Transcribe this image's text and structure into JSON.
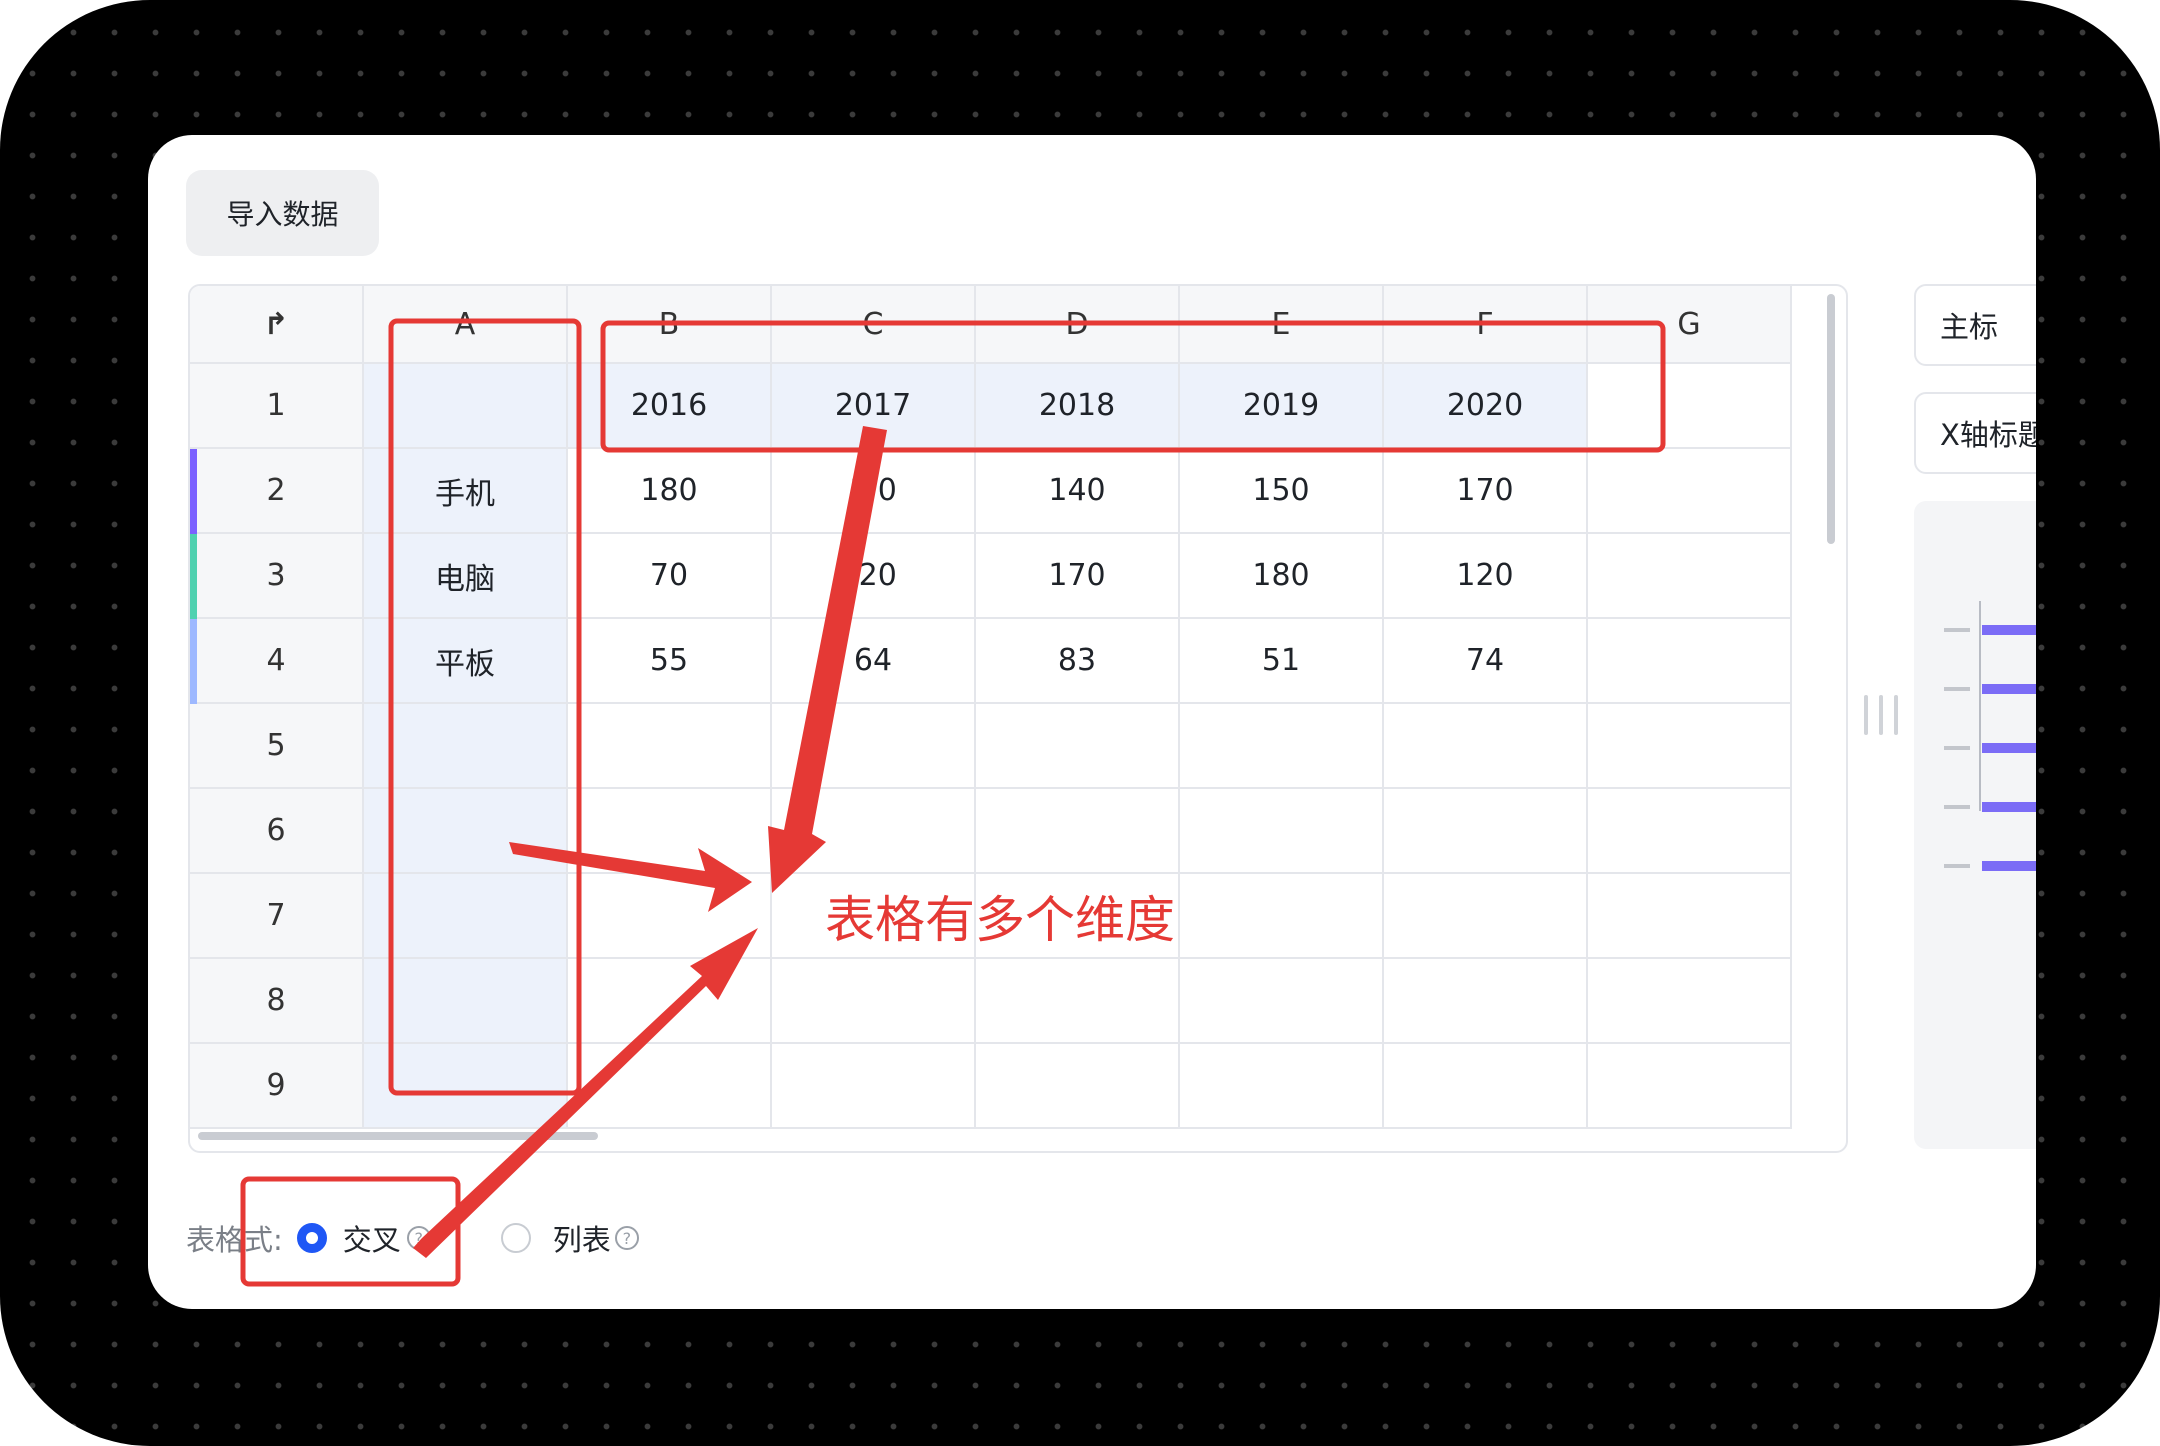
{
  "toolbar": {
    "import_label": "导入数据"
  },
  "sheet": {
    "corner_icon": "return-arrow-icon",
    "columns": [
      "A",
      "B",
      "C",
      "D",
      "E",
      "F",
      "G"
    ],
    "rows": [
      [
        "",
        "2016",
        "2017",
        "2018",
        "2019",
        "2020",
        ""
      ],
      [
        "手机",
        "180",
        "1·0",
        "140",
        "150",
        "170",
        ""
      ],
      [
        "电脑",
        "70",
        "·20",
        "170",
        "180",
        "120",
        ""
      ],
      [
        "平板",
        "55",
        "64",
        "83",
        "51",
        "74",
        ""
      ],
      [
        "",
        "",
        "",
        "",
        "",
        "",
        ""
      ],
      [
        "",
        "",
        "",
        "",
        "",
        "",
        ""
      ],
      [
        "",
        "",
        "",
        "",
        "",
        "",
        ""
      ],
      [
        "",
        "",
        "",
        "",
        "",
        "",
        ""
      ],
      [
        "",
        "",
        "",
        "",
        "",
        "",
        ""
      ]
    ],
    "row_numbers": [
      "1",
      "2",
      "3",
      "4",
      "5",
      "6",
      "7",
      "8",
      "9"
    ],
    "series_colors": [
      "#7b61ff",
      "#4fd1b0",
      "#9db8ff"
    ]
  },
  "side_panel": {
    "main_title_label": "主标",
    "x_axis_title_label": "X轴标题",
    "preview_bar_color": "#7b6cf6"
  },
  "format": {
    "label": "表格式:",
    "options": [
      {
        "label": "交叉",
        "selected": true
      },
      {
        "label": "列表",
        "selected": false
      }
    ],
    "help_glyph": "?"
  },
  "annotation": {
    "text": "表格有多个维度",
    "color": "#e53935"
  }
}
